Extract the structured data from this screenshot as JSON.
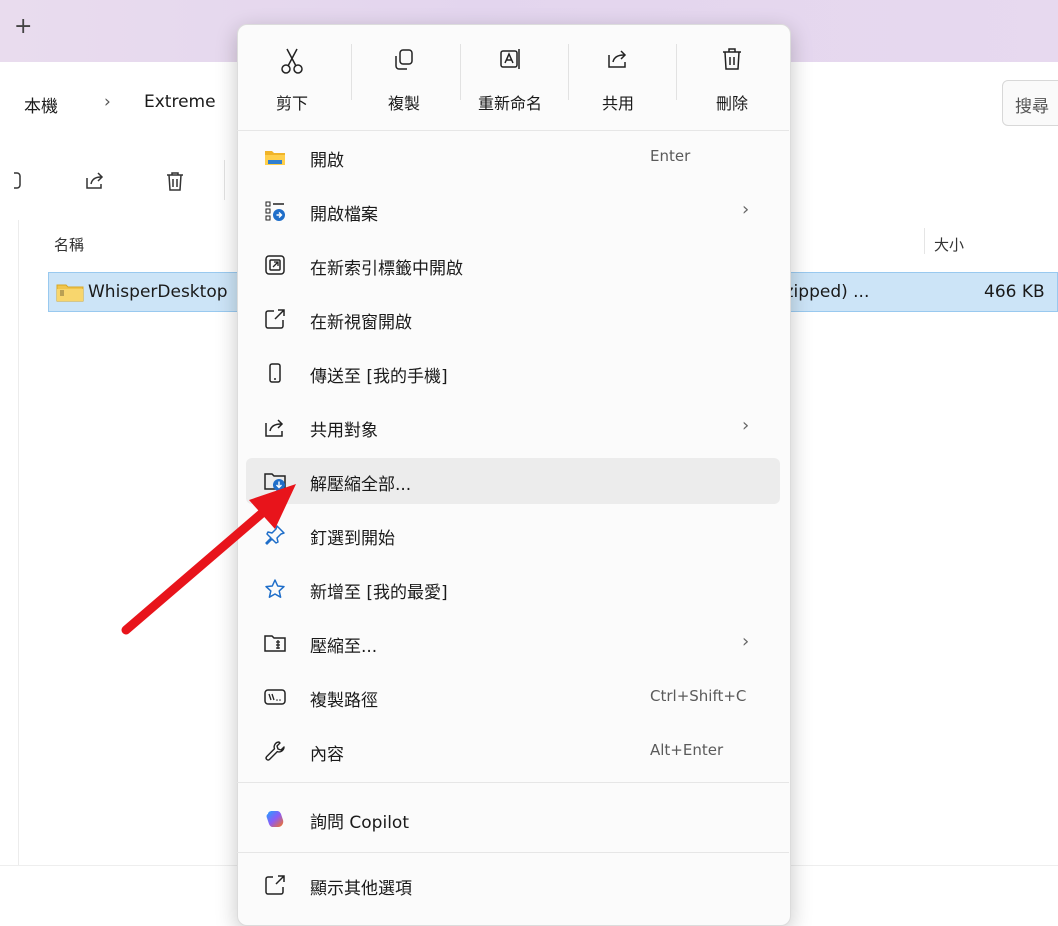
{
  "window": {
    "new_tab": "+",
    "breadcrumb": [
      "本機",
      "›",
      "Extreme"
    ],
    "search_placeholder": "搜尋"
  },
  "file_list": {
    "columns": {
      "name": "名稱",
      "size": "大小"
    },
    "rows": [
      {
        "name": "WhisperDesktop",
        "type": "(zipped) ...",
        "size": "466 KB"
      }
    ]
  },
  "context_menu": {
    "quick_actions": [
      {
        "label": "剪下",
        "icon": "scissors-icon"
      },
      {
        "label": "複製",
        "icon": "copy-icon"
      },
      {
        "label": "重新命名",
        "icon": "rename-icon"
      },
      {
        "label": "共用",
        "icon": "share-icon"
      },
      {
        "label": "刪除",
        "icon": "trash-icon"
      }
    ],
    "items": [
      {
        "label": "開啟",
        "shortcut": "Enter",
        "icon": "folder-icon"
      },
      {
        "label": "開啟檔案",
        "submenu": "›",
        "icon": "open-with-icon"
      },
      {
        "label": "在新索引標籤中開啟",
        "icon": "new-tab-icon"
      },
      {
        "label": "在新視窗開啟",
        "icon": "new-window-icon"
      },
      {
        "label": "傳送至 [我的手機]",
        "icon": "phone-icon"
      },
      {
        "label": "共用對象",
        "submenu": "›",
        "icon": "share-icon"
      },
      {
        "label": "解壓縮全部...",
        "icon": "extract-icon",
        "highlighted": true
      },
      {
        "label": "釘選到開始",
        "icon": "pin-icon"
      },
      {
        "label": "新增至 [我的最愛]",
        "icon": "star-icon"
      },
      {
        "label": "壓縮至...",
        "submenu": "›",
        "icon": "zip-folder-icon"
      },
      {
        "label": "複製路徑",
        "shortcut": "Ctrl+Shift+C",
        "icon": "copy-path-icon"
      },
      {
        "label": "內容",
        "shortcut": "Alt+Enter",
        "icon": "wrench-icon"
      }
    ],
    "copilot": {
      "label": "詢問 Copilot",
      "icon": "copilot-icon"
    },
    "more": {
      "label": "顯示其他選項",
      "icon": "more-options-icon"
    }
  },
  "colors": {
    "annotation_arrow": "#e8141b",
    "selection": "#cce4f7",
    "hover": "#ececec"
  }
}
